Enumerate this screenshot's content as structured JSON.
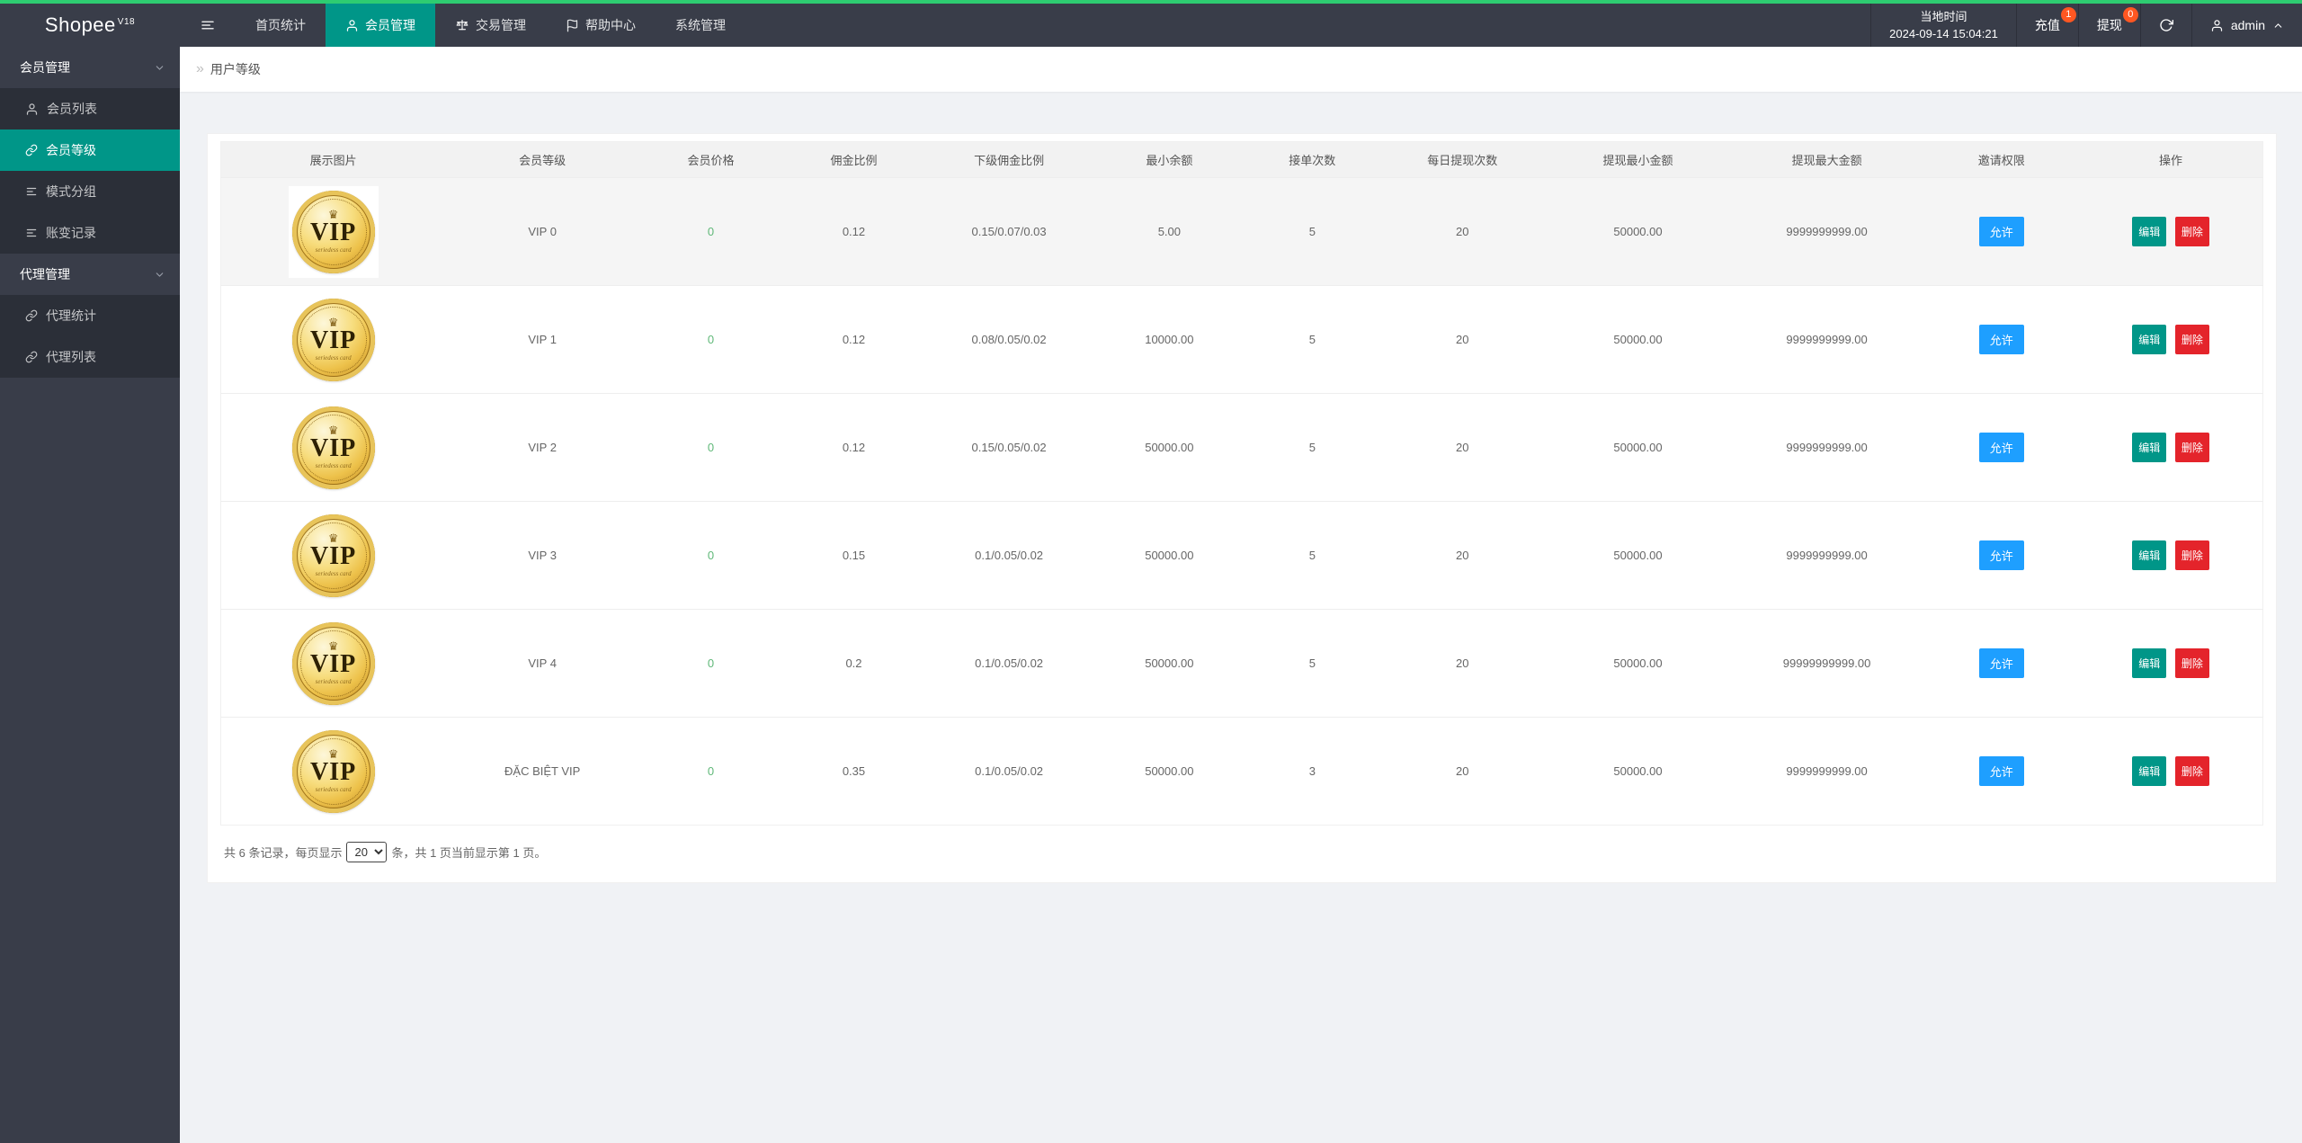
{
  "navbar": {
    "logo": "Shopee",
    "logo_version": "V18",
    "items": [
      {
        "label": "首页统计",
        "icon": "",
        "active": false
      },
      {
        "label": "会员管理",
        "icon": "user-icon",
        "active": true
      },
      {
        "label": "交易管理",
        "icon": "scales-icon",
        "active": false
      },
      {
        "label": "帮助中心",
        "icon": "flag-icon",
        "active": false
      },
      {
        "label": "系统管理",
        "icon": "",
        "active": false
      }
    ],
    "local_time_label": "当地时间",
    "local_time": "2024-09-14 15:04:21",
    "recharge": {
      "label": "充值",
      "badge": "1"
    },
    "withdraw": {
      "label": "提现",
      "badge": "0"
    },
    "admin_name": "admin"
  },
  "sidebar": {
    "items": [
      {
        "type": "parent",
        "label": "会员管理",
        "chevron": "down",
        "active": false
      },
      {
        "type": "child",
        "label": "会员列表",
        "icon": "user-icon",
        "active": false
      },
      {
        "type": "child",
        "label": "会员等级",
        "icon": "link-icon",
        "active": true
      },
      {
        "type": "child",
        "label": "模式分组",
        "icon": "list-icon",
        "active": false
      },
      {
        "type": "child",
        "label": "账变记录",
        "icon": "list-icon",
        "active": false
      },
      {
        "type": "parent",
        "label": "代理管理",
        "chevron": "down",
        "active": false
      },
      {
        "type": "child",
        "label": "代理统计",
        "icon": "link-icon",
        "active": false
      },
      {
        "type": "child",
        "label": "代理列表",
        "icon": "link-icon",
        "active": false
      }
    ]
  },
  "breadcrumb": {
    "label": "用户等级",
    "chevron": "»"
  },
  "table": {
    "coin_text": "VIP",
    "coin_crown": "♛",
    "coin_scribble": "seriedess card",
    "columns": [
      "展示图片",
      "会员等级",
      "会员价格",
      "佣金比例",
      "下级佣金比例",
      "最小余额",
      "接单次数",
      "每日提现次数",
      "提现最小金额",
      "提现最大金额",
      "邀请权限",
      "操作"
    ],
    "actions": {
      "edit": "编辑",
      "delete": "删除"
    },
    "rows": [
      {
        "level": "VIP 0",
        "price": "0",
        "commission": "0.12",
        "sub_commission": "0.15/0.07/0.03",
        "min_balance": "5.00",
        "orders": "5",
        "daily_withdrawals": "20",
        "min_withdrawal": "50000.00",
        "max_withdrawal": "9999999999.00",
        "invite": "允许",
        "highlight": true
      },
      {
        "level": "VIP 1",
        "price": "0",
        "commission": "0.12",
        "sub_commission": "0.08/0.05/0.02",
        "min_balance": "10000.00",
        "orders": "5",
        "daily_withdrawals": "20",
        "min_withdrawal": "50000.00",
        "max_withdrawal": "9999999999.00",
        "invite": "允许",
        "highlight": false
      },
      {
        "level": "VIP 2",
        "price": "0",
        "commission": "0.12",
        "sub_commission": "0.15/0.05/0.02",
        "min_balance": "50000.00",
        "orders": "5",
        "daily_withdrawals": "20",
        "min_withdrawal": "50000.00",
        "max_withdrawal": "9999999999.00",
        "invite": "允许",
        "highlight": false
      },
      {
        "level": "VIP 3",
        "price": "0",
        "commission": "0.15",
        "sub_commission": "0.1/0.05/0.02",
        "min_balance": "50000.00",
        "orders": "5",
        "daily_withdrawals": "20",
        "min_withdrawal": "50000.00",
        "max_withdrawal": "9999999999.00",
        "invite": "允许",
        "highlight": false
      },
      {
        "level": "VIP 4",
        "price": "0",
        "commission": "0.2",
        "sub_commission": "0.1/0.05/0.02",
        "min_balance": "50000.00",
        "orders": "5",
        "daily_withdrawals": "20",
        "min_withdrawal": "50000.00",
        "max_withdrawal": "99999999999.00",
        "invite": "允许",
        "highlight": false
      },
      {
        "level": "ĐẶC BIỆT VIP",
        "price": "0",
        "commission": "0.35",
        "sub_commission": "0.1/0.05/0.02",
        "min_balance": "50000.00",
        "orders": "3",
        "daily_withdrawals": "20",
        "min_withdrawal": "50000.00",
        "max_withdrawal": "9999999999.00",
        "invite": "允许",
        "highlight": false
      }
    ]
  },
  "pagination": {
    "prefix": "共 6 条记录，每页显示",
    "per_page": "20",
    "suffix": "条，共 1 页当前显示第 1 页。"
  },
  "colors": {
    "top_strip": "#2ecc71",
    "navbar_bg": "#393D49",
    "active_teal": "#009688",
    "allow_blue": "#1E9FFF",
    "edit_green": "#009688",
    "delete_red": "#e4242b",
    "price_green": "#5FB878",
    "badge_orange": "#FF5722"
  }
}
